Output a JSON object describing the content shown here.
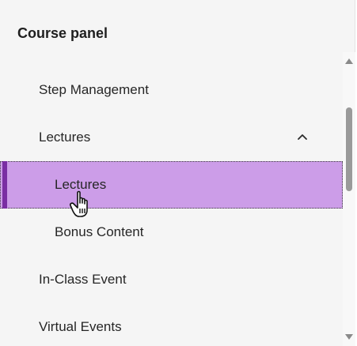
{
  "panel": {
    "title": "Course panel"
  },
  "nav": {
    "items": [
      {
        "label": "Step Management"
      },
      {
        "label": "Lectures",
        "expanded": true,
        "icon": "chevron-up-icon"
      },
      {
        "label": "Lectures",
        "selected": true
      },
      {
        "label": "Bonus Content"
      },
      {
        "label": "In-Class Event"
      },
      {
        "label": "Virtual Events"
      }
    ]
  },
  "colors": {
    "panel_bg": "#f5f5f5",
    "selected_bg": "#cc9de8",
    "selected_accent": "#7a2ea3",
    "scroll_thumb": "#9a9a9a"
  }
}
